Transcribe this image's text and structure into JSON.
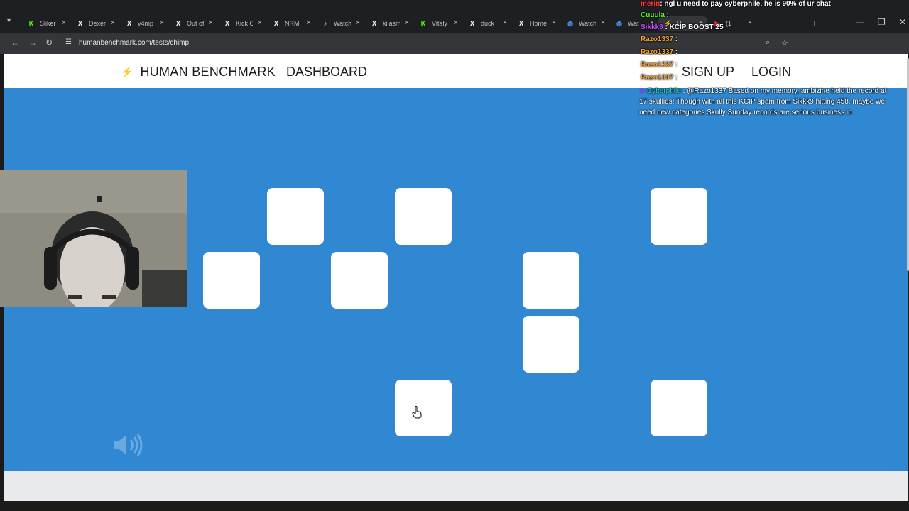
{
  "browser": {
    "tabs": [
      {
        "title": "Sliker",
        "favicon": "kick-icon",
        "color": "#53fc18"
      },
      {
        "title": "Dexer",
        "favicon": "x-icon",
        "color": "#ffffff"
      },
      {
        "title": "v4mp",
        "favicon": "x-icon",
        "color": "#ffffff"
      },
      {
        "title": "Out of",
        "favicon": "x-icon",
        "color": "#ffffff"
      },
      {
        "title": "Kick C",
        "favicon": "x-icon",
        "color": "#ffffff"
      },
      {
        "title": "NRM",
        "favicon": "x-icon",
        "color": "#ffffff"
      },
      {
        "title": "Watch",
        "favicon": "tiktok-icon",
        "color": "#ffffff"
      },
      {
        "title": "kilasm",
        "favicon": "x-icon",
        "color": "#ffffff"
      },
      {
        "title": "Vitaly",
        "favicon": "kick-icon",
        "color": "#53fc18"
      },
      {
        "title": "duck",
        "favicon": "x-icon",
        "color": "#ffffff"
      },
      {
        "title": "Home",
        "favicon": "x-icon",
        "color": "#ffffff"
      },
      {
        "title": "Watch",
        "favicon": "globe-icon",
        "color": "#4aa3ff"
      },
      {
        "title": "Wat",
        "favicon": "globe-icon",
        "color": "#4aa3ff"
      },
      {
        "title": "Hi",
        "favicon": "hb-icon",
        "color": "#f0a030",
        "active": true
      },
      {
        "title": "(1",
        "favicon": "youtube-icon",
        "color": "#ff2d2d"
      }
    ],
    "url": "humanbenchmark.com/tests/chimp"
  },
  "site": {
    "brand": "HUMAN BENCHMARK",
    "dashboard": "DASHBOARD",
    "signup": "SIGN UP",
    "login": "LOGIN"
  },
  "game": {
    "remaining_tiles": 10,
    "background": "#3088d2"
  },
  "chat": {
    "lines": [
      {
        "user": "merin",
        "text": ": ngl u need to pay cyberphile, he is 90% of ur chat",
        "color": "#ff3b3b"
      },
      {
        "user": "Cuuula",
        "text": " :",
        "color": "#53fc18"
      },
      {
        "user": "Sikkk9",
        "text": " : KCIP BOOST 25",
        "color": "#c04bff"
      },
      {
        "user": "Razo1337",
        "text": " :",
        "color": "#f0a030"
      },
      {
        "user": "Razo1337",
        "text": " :",
        "color": "#f0a030"
      },
      {
        "user": "Razo1337",
        "text": " :",
        "color": "#f0a030"
      },
      {
        "user": "Razo1337",
        "text": " :",
        "color": "#f0a030"
      }
    ],
    "message_user": "Cyberphile",
    "message_user_color": "#2bd4c0",
    "message_text": " : @Razo1337 Based on my memory, ambizine held the record at 17 skullies!  Though with all this KCIP spam from Sikkk9 hitting 458, maybe we need new categories  Skully Sunday records are serious business in"
  }
}
